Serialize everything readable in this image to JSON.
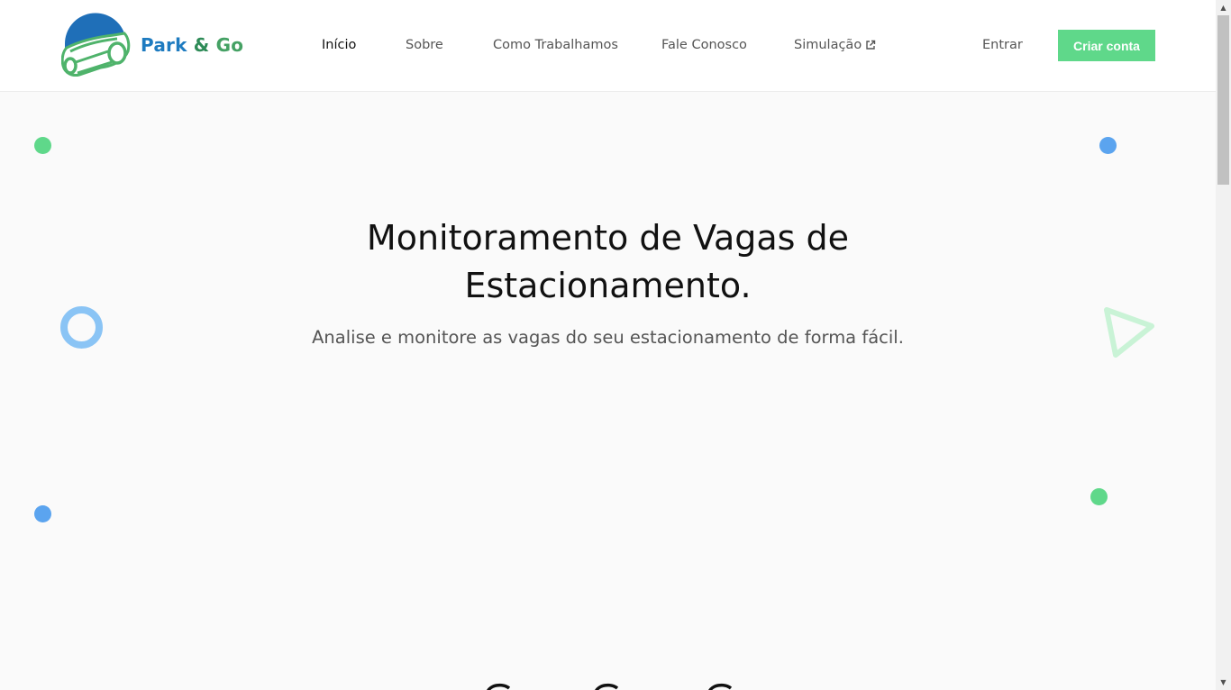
{
  "brand": {
    "name_part1": "Park",
    "name_part2": "&",
    "name_part3": "Go"
  },
  "nav": {
    "items": [
      {
        "label": "Início",
        "active": true
      },
      {
        "label": "Sobre",
        "active": false
      },
      {
        "label": "Como Trabalhamos",
        "active": false
      },
      {
        "label": "Fale Conosco",
        "active": false
      },
      {
        "label": "Simulação",
        "active": false,
        "icon": "external-link-icon"
      }
    ],
    "login_label": "Entrar",
    "signup_label": "Criar conta"
  },
  "hero": {
    "title_line1": "Monitoramento de Vagas de",
    "title_line2": "Estacionamento.",
    "subtitle": "Analise e monitore as vagas do seu estacionamento de forma fácil."
  },
  "colors": {
    "accent_green": "#5fd88a",
    "accent_blue": "#5ba4ef",
    "brand_blue": "#1e7bc0",
    "brand_green": "#2e8b57"
  },
  "decorations": [
    "green-dot",
    "blue-dot",
    "blue-ring",
    "green-triangle-outline"
  ]
}
